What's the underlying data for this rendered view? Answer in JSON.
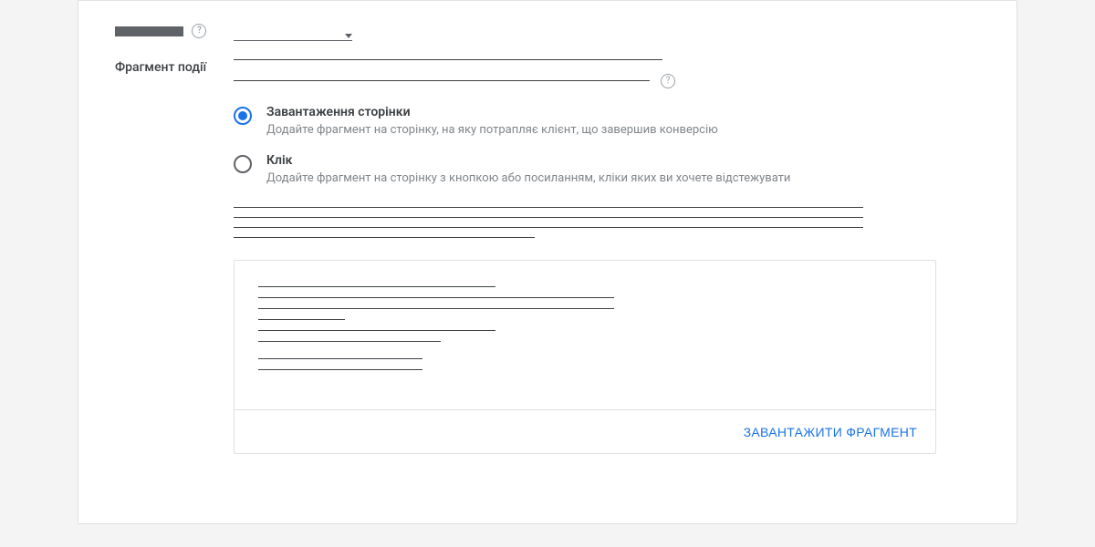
{
  "section": {
    "fragment_label": "Фрагмент події"
  },
  "radios": {
    "page_load": {
      "title": "Завантаження сторінки",
      "desc": "Додайте фрагмент на сторінку, на яку потрапляє клієнт, що завершив конверсію"
    },
    "click": {
      "title": "Клік",
      "desc": "Додайте фрагмент на сторінку з кнопкою або посиланням, кліки яких ви хочете відстежувати"
    }
  },
  "actions": {
    "download": "ЗАВАНТАЖИТИ ФРАГМЕНТ"
  }
}
